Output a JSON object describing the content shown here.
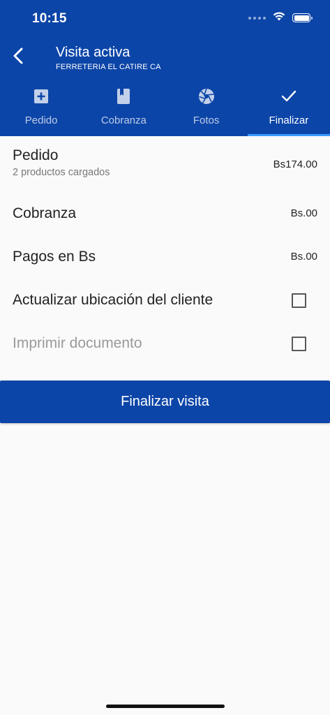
{
  "status_bar": {
    "time": "10:15",
    "icons": [
      "signal-icon",
      "wifi-icon",
      "battery-icon"
    ]
  },
  "header": {
    "back_icon": "chevron-left-icon",
    "title": "Visita activa",
    "subtitle": "FERRETERIA EL CATIRE CA",
    "background": "#0c45a8"
  },
  "tabs": [
    {
      "label": "Pedido",
      "icon": "plus-box-icon",
      "active": false
    },
    {
      "label": "Cobranza",
      "icon": "book-icon",
      "active": false
    },
    {
      "label": "Fotos",
      "icon": "camera-aperture-icon",
      "active": false
    },
    {
      "label": "Finalizar",
      "icon": "check-icon",
      "active": true
    }
  ],
  "tab_indicator_color": "#3a9bff",
  "rows": {
    "pedido": {
      "title": "Pedido",
      "subtitle": "2 productos cargados",
      "value": "Bs174.00"
    },
    "cobranza": {
      "title": "Cobranza",
      "value": "Bs.00"
    },
    "pagos": {
      "title": "Pagos en Bs",
      "value": "Bs.00"
    },
    "actualizar": {
      "title": "Actualizar ubicación del cliente",
      "checked": false
    },
    "imprimir": {
      "title": "Imprimir documento",
      "checked": false
    }
  },
  "finish_button": {
    "label": "Finalizar visita",
    "color": "#0c45a8"
  }
}
